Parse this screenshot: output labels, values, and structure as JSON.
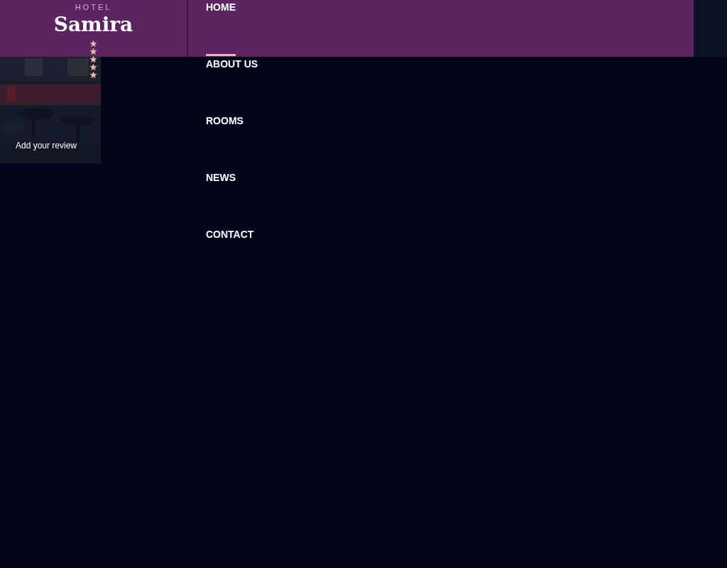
{
  "logo": {
    "kicker": "HOTEL",
    "name": "Samira"
  },
  "nav": [
    {
      "label": "HOME",
      "selected": true
    },
    {
      "label": "ABOUT US",
      "selected": false
    },
    {
      "label": "ROOMS",
      "selected": false
    },
    {
      "label": "NEWS",
      "selected": false
    },
    {
      "label": "CONTACT",
      "selected": false
    }
  ],
  "review_card": {
    "kind": "picture",
    "label": "Add your review"
  }
}
